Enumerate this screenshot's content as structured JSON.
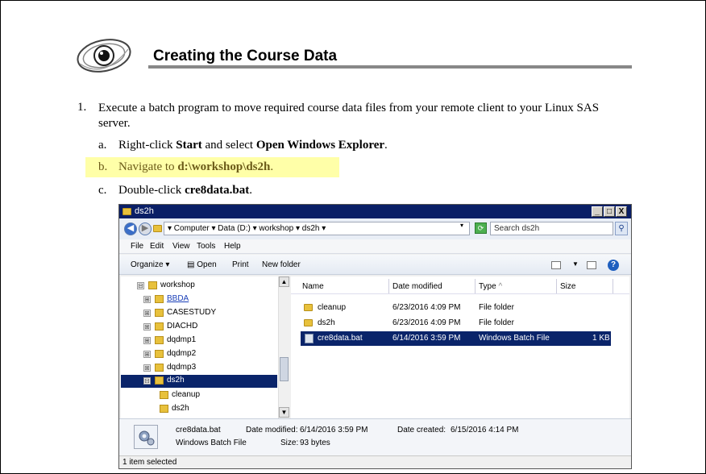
{
  "header": {
    "title": "Creating the Course Data"
  },
  "instructions": {
    "step_number": "1.",
    "step_text": "Execute a batch program to move required course data files from your remote client to your Linux SAS server.",
    "substeps": [
      {
        "label": "a.",
        "pre": "Right-click ",
        "b1": "Start",
        "mid": " and select ",
        "b2": "Open Windows Explorer",
        "post": "."
      },
      {
        "label": "b.",
        "pre": "Navigate to ",
        "b1": "d:\\workshop\\ds2h",
        "post": "."
      },
      {
        "label": "c.",
        "pre": "Double-click ",
        "b1": "cre8data.bat",
        "post": "."
      }
    ]
  },
  "explorer": {
    "window_title": "ds2h",
    "title_buttons": [
      "_",
      "□",
      "X"
    ],
    "nav": {
      "back": "◀",
      "forward": "▶"
    },
    "address": "▾ Computer ▾ Data (D:) ▾ workshop ▾ ds2h ▾",
    "address_dropdown": "▾",
    "search_placeholder": "Search ds2h",
    "menu": [
      "File",
      "Edit",
      "View",
      "Tools",
      "Help"
    ],
    "commands": {
      "organize": "Organize ▾",
      "open": "Open",
      "print": "Print",
      "new_folder": "New folder"
    },
    "help": "?",
    "tree": [
      {
        "label": "workshop",
        "exp": "⊟"
      },
      {
        "label": "BBDA",
        "exp": "⊞"
      },
      {
        "label": "CASESTUDY",
        "exp": "⊞"
      },
      {
        "label": "DIACHD",
        "exp": "⊞"
      },
      {
        "label": "dqdmp1",
        "exp": "⊞"
      },
      {
        "label": "dqdmp2",
        "exp": "⊞"
      },
      {
        "label": "dqdmp3",
        "exp": "⊞"
      },
      {
        "label": "ds2h",
        "exp": "⊟"
      },
      {
        "label": "cleanup",
        "exp": ""
      },
      {
        "label": "ds2h",
        "exp": ""
      }
    ],
    "columns": {
      "name": "Name",
      "date": "Date modified",
      "type": "Type",
      "type_sort": "^",
      "size": "Size"
    },
    "files": [
      {
        "name": "cleanup",
        "date": "6/23/2016 4:09 PM",
        "type": "File folder",
        "size": ""
      },
      {
        "name": "ds2h",
        "date": "6/23/2016 4:09 PM",
        "type": "File folder",
        "size": ""
      },
      {
        "name": "cre8data.bat",
        "date": "6/14/2016 3:59 PM",
        "type": "Windows Batch File",
        "size": "1 KB"
      }
    ],
    "details": {
      "name": "cre8data.bat",
      "kind": "Windows Batch File",
      "modified_label": "Date modified:",
      "modified": "6/14/2016 3:59 PM",
      "created_label": "Date created:",
      "created": "6/15/2016 4:14 PM",
      "size_label": "Size:",
      "size": "93 bytes"
    },
    "status": "1 item selected"
  }
}
